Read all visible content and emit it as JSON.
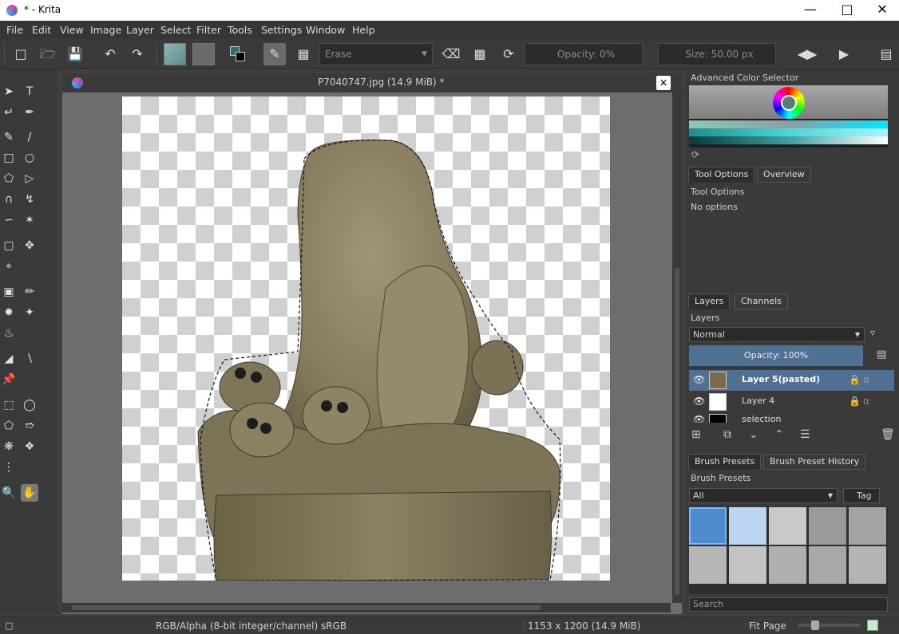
{
  "window": {
    "title": "* - Krita"
  },
  "menu": [
    "File",
    "Edit",
    "View",
    "Image",
    "Layer",
    "Select",
    "Filter",
    "Tools",
    "Settings",
    "Window",
    "Help"
  ],
  "toolbar": {
    "blend_mode": "Erase",
    "opacity": "Opacity: 0%",
    "size": "Size: 50.00 px"
  },
  "document": {
    "title": "P7040747.jpg (14.9 MiB) *"
  },
  "color_selector": {
    "title": "Advanced Color Selector"
  },
  "tool_options": {
    "tabs": [
      "Tool Options",
      "Overview"
    ],
    "header": "Tool Options",
    "text": "No options"
  },
  "layers": {
    "tabs": [
      "Layers",
      "Channels"
    ],
    "header": "Layers",
    "blend_mode": "Normal",
    "opacity": "Opacity:  100%",
    "items": [
      "Layer 5(pasted)",
      "Layer 4",
      "selection"
    ]
  },
  "brush_presets": {
    "tabs": [
      "Brush Presets",
      "Brush Preset History"
    ],
    "header": "Brush Presets",
    "filter": "All",
    "tag": "Tag",
    "search_placeholder": "Search"
  },
  "status": {
    "color_model": "RGB/Alpha (8-bit integer/channel)  sRGB",
    "dimensions": "1153 x 1200 (14.9 MiB)",
    "zoom": "Fit Page"
  },
  "colors": {
    "accent": "#5a7fa8",
    "layer_selected": "#4f6f93"
  }
}
